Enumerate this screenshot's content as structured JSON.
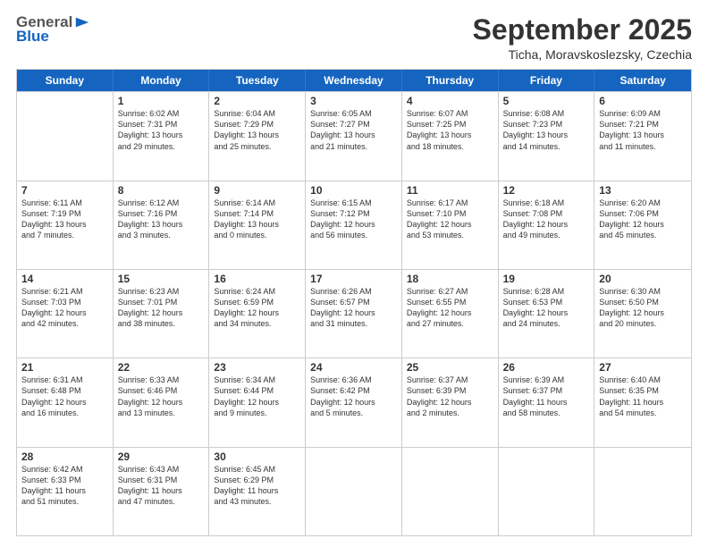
{
  "header": {
    "logo_general": "General",
    "logo_blue": "Blue",
    "month_title": "September 2025",
    "location": "Ticha, Moravskoslezsky, Czechia"
  },
  "days_of_week": [
    "Sunday",
    "Monday",
    "Tuesday",
    "Wednesday",
    "Thursday",
    "Friday",
    "Saturday"
  ],
  "weeks": [
    [
      {
        "day": "",
        "lines": []
      },
      {
        "day": "1",
        "lines": [
          "Sunrise: 6:02 AM",
          "Sunset: 7:31 PM",
          "Daylight: 13 hours",
          "and 29 minutes."
        ]
      },
      {
        "day": "2",
        "lines": [
          "Sunrise: 6:04 AM",
          "Sunset: 7:29 PM",
          "Daylight: 13 hours",
          "and 25 minutes."
        ]
      },
      {
        "day": "3",
        "lines": [
          "Sunrise: 6:05 AM",
          "Sunset: 7:27 PM",
          "Daylight: 13 hours",
          "and 21 minutes."
        ]
      },
      {
        "day": "4",
        "lines": [
          "Sunrise: 6:07 AM",
          "Sunset: 7:25 PM",
          "Daylight: 13 hours",
          "and 18 minutes."
        ]
      },
      {
        "day": "5",
        "lines": [
          "Sunrise: 6:08 AM",
          "Sunset: 7:23 PM",
          "Daylight: 13 hours",
          "and 14 minutes."
        ]
      },
      {
        "day": "6",
        "lines": [
          "Sunrise: 6:09 AM",
          "Sunset: 7:21 PM",
          "Daylight: 13 hours",
          "and 11 minutes."
        ]
      }
    ],
    [
      {
        "day": "7",
        "lines": [
          "Sunrise: 6:11 AM",
          "Sunset: 7:19 PM",
          "Daylight: 13 hours",
          "and 7 minutes."
        ]
      },
      {
        "day": "8",
        "lines": [
          "Sunrise: 6:12 AM",
          "Sunset: 7:16 PM",
          "Daylight: 13 hours",
          "and 3 minutes."
        ]
      },
      {
        "day": "9",
        "lines": [
          "Sunrise: 6:14 AM",
          "Sunset: 7:14 PM",
          "Daylight: 13 hours",
          "and 0 minutes."
        ]
      },
      {
        "day": "10",
        "lines": [
          "Sunrise: 6:15 AM",
          "Sunset: 7:12 PM",
          "Daylight: 12 hours",
          "and 56 minutes."
        ]
      },
      {
        "day": "11",
        "lines": [
          "Sunrise: 6:17 AM",
          "Sunset: 7:10 PM",
          "Daylight: 12 hours",
          "and 53 minutes."
        ]
      },
      {
        "day": "12",
        "lines": [
          "Sunrise: 6:18 AM",
          "Sunset: 7:08 PM",
          "Daylight: 12 hours",
          "and 49 minutes."
        ]
      },
      {
        "day": "13",
        "lines": [
          "Sunrise: 6:20 AM",
          "Sunset: 7:06 PM",
          "Daylight: 12 hours",
          "and 45 minutes."
        ]
      }
    ],
    [
      {
        "day": "14",
        "lines": [
          "Sunrise: 6:21 AM",
          "Sunset: 7:03 PM",
          "Daylight: 12 hours",
          "and 42 minutes."
        ]
      },
      {
        "day": "15",
        "lines": [
          "Sunrise: 6:23 AM",
          "Sunset: 7:01 PM",
          "Daylight: 12 hours",
          "and 38 minutes."
        ]
      },
      {
        "day": "16",
        "lines": [
          "Sunrise: 6:24 AM",
          "Sunset: 6:59 PM",
          "Daylight: 12 hours",
          "and 34 minutes."
        ]
      },
      {
        "day": "17",
        "lines": [
          "Sunrise: 6:26 AM",
          "Sunset: 6:57 PM",
          "Daylight: 12 hours",
          "and 31 minutes."
        ]
      },
      {
        "day": "18",
        "lines": [
          "Sunrise: 6:27 AM",
          "Sunset: 6:55 PM",
          "Daylight: 12 hours",
          "and 27 minutes."
        ]
      },
      {
        "day": "19",
        "lines": [
          "Sunrise: 6:28 AM",
          "Sunset: 6:53 PM",
          "Daylight: 12 hours",
          "and 24 minutes."
        ]
      },
      {
        "day": "20",
        "lines": [
          "Sunrise: 6:30 AM",
          "Sunset: 6:50 PM",
          "Daylight: 12 hours",
          "and 20 minutes."
        ]
      }
    ],
    [
      {
        "day": "21",
        "lines": [
          "Sunrise: 6:31 AM",
          "Sunset: 6:48 PM",
          "Daylight: 12 hours",
          "and 16 minutes."
        ]
      },
      {
        "day": "22",
        "lines": [
          "Sunrise: 6:33 AM",
          "Sunset: 6:46 PM",
          "Daylight: 12 hours",
          "and 13 minutes."
        ]
      },
      {
        "day": "23",
        "lines": [
          "Sunrise: 6:34 AM",
          "Sunset: 6:44 PM",
          "Daylight: 12 hours",
          "and 9 minutes."
        ]
      },
      {
        "day": "24",
        "lines": [
          "Sunrise: 6:36 AM",
          "Sunset: 6:42 PM",
          "Daylight: 12 hours",
          "and 5 minutes."
        ]
      },
      {
        "day": "25",
        "lines": [
          "Sunrise: 6:37 AM",
          "Sunset: 6:39 PM",
          "Daylight: 12 hours",
          "and 2 minutes."
        ]
      },
      {
        "day": "26",
        "lines": [
          "Sunrise: 6:39 AM",
          "Sunset: 6:37 PM",
          "Daylight: 11 hours",
          "and 58 minutes."
        ]
      },
      {
        "day": "27",
        "lines": [
          "Sunrise: 6:40 AM",
          "Sunset: 6:35 PM",
          "Daylight: 11 hours",
          "and 54 minutes."
        ]
      }
    ],
    [
      {
        "day": "28",
        "lines": [
          "Sunrise: 6:42 AM",
          "Sunset: 6:33 PM",
          "Daylight: 11 hours",
          "and 51 minutes."
        ]
      },
      {
        "day": "29",
        "lines": [
          "Sunrise: 6:43 AM",
          "Sunset: 6:31 PM",
          "Daylight: 11 hours",
          "and 47 minutes."
        ]
      },
      {
        "day": "30",
        "lines": [
          "Sunrise: 6:45 AM",
          "Sunset: 6:29 PM",
          "Daylight: 11 hours",
          "and 43 minutes."
        ]
      },
      {
        "day": "",
        "lines": []
      },
      {
        "day": "",
        "lines": []
      },
      {
        "day": "",
        "lines": []
      },
      {
        "day": "",
        "lines": []
      }
    ]
  ]
}
